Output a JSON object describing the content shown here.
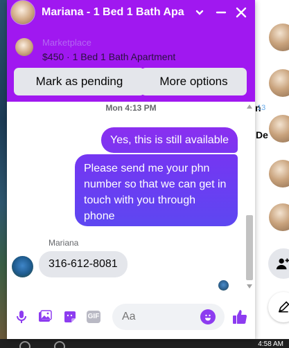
{
  "header": {
    "title": "Mariana - 1 Bed 1 Bath Apa",
    "colors": {
      "accent": "#a018f0",
      "bubble": "#7b36f0"
    }
  },
  "listing": {
    "source": "Marketplace",
    "description": "$450 · 1 Bed 1 Bath Apartment"
  },
  "actions": {
    "mark_pending": "Mark as pending",
    "more_options": "More options"
  },
  "messages": {
    "timestamp": "Mon 4:13 PM",
    "outgoing": [
      "Yes, this is still available",
      "Please send me your phn number so that we can get in touch with you through phone"
    ],
    "sender": "Mariana",
    "incoming": "316-612-8081"
  },
  "composer": {
    "placeholder": "Aa",
    "gif_label": "GIF",
    "icons": [
      "microphone-icon",
      "photo-icon",
      "sticker-icon",
      "gif-icon",
      "emoji-icon",
      "thumbs-up-icon"
    ]
  },
  "background": {
    "snippet_letter": "n",
    "snippet_number": "13",
    "snippet_word": "De",
    "clock": "4:58 AM"
  }
}
